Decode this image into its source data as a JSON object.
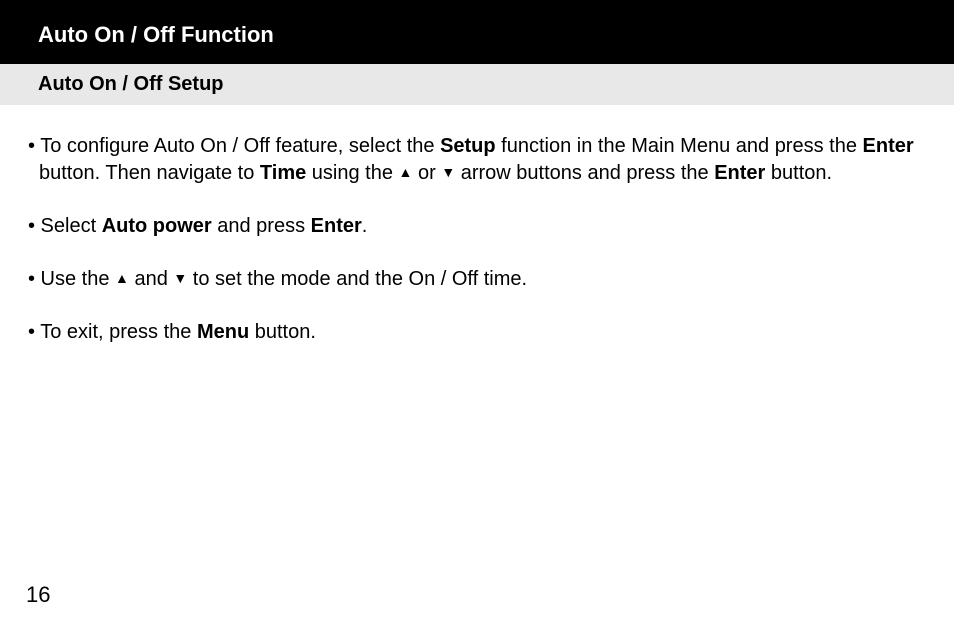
{
  "header": {
    "title": "Auto On / Off Function"
  },
  "subheader": {
    "title": "Auto On / Off Setup"
  },
  "content": {
    "bullet1": {
      "pre": "•  To configure Auto On / Off feature, select the ",
      "bold1": "Setup",
      "mid1": " function in the Main Menu and press the ",
      "bold2": "Enter",
      "mid2": " button.  Then navigate to ",
      "bold3": "Time",
      "mid3": " using the ",
      "up1": "▲",
      "mid4": " or ",
      "down1": "▼",
      "mid5": " arrow buttons and press the ",
      "bold4": "Enter",
      "post": " button."
    },
    "bullet2": {
      "pre": "• Select ",
      "bold1": "Auto power",
      "mid": " and press ",
      "bold2": "Enter",
      "post": "."
    },
    "bullet3": {
      "pre": "• Use the ",
      "up": "▲",
      "mid1": " and ",
      "down": "▼",
      "post": " to set the mode and the On / Off time."
    },
    "bullet4": {
      "pre": "• To exit, press the ",
      "bold1": "Menu",
      "post": " button."
    }
  },
  "page_number": "16"
}
